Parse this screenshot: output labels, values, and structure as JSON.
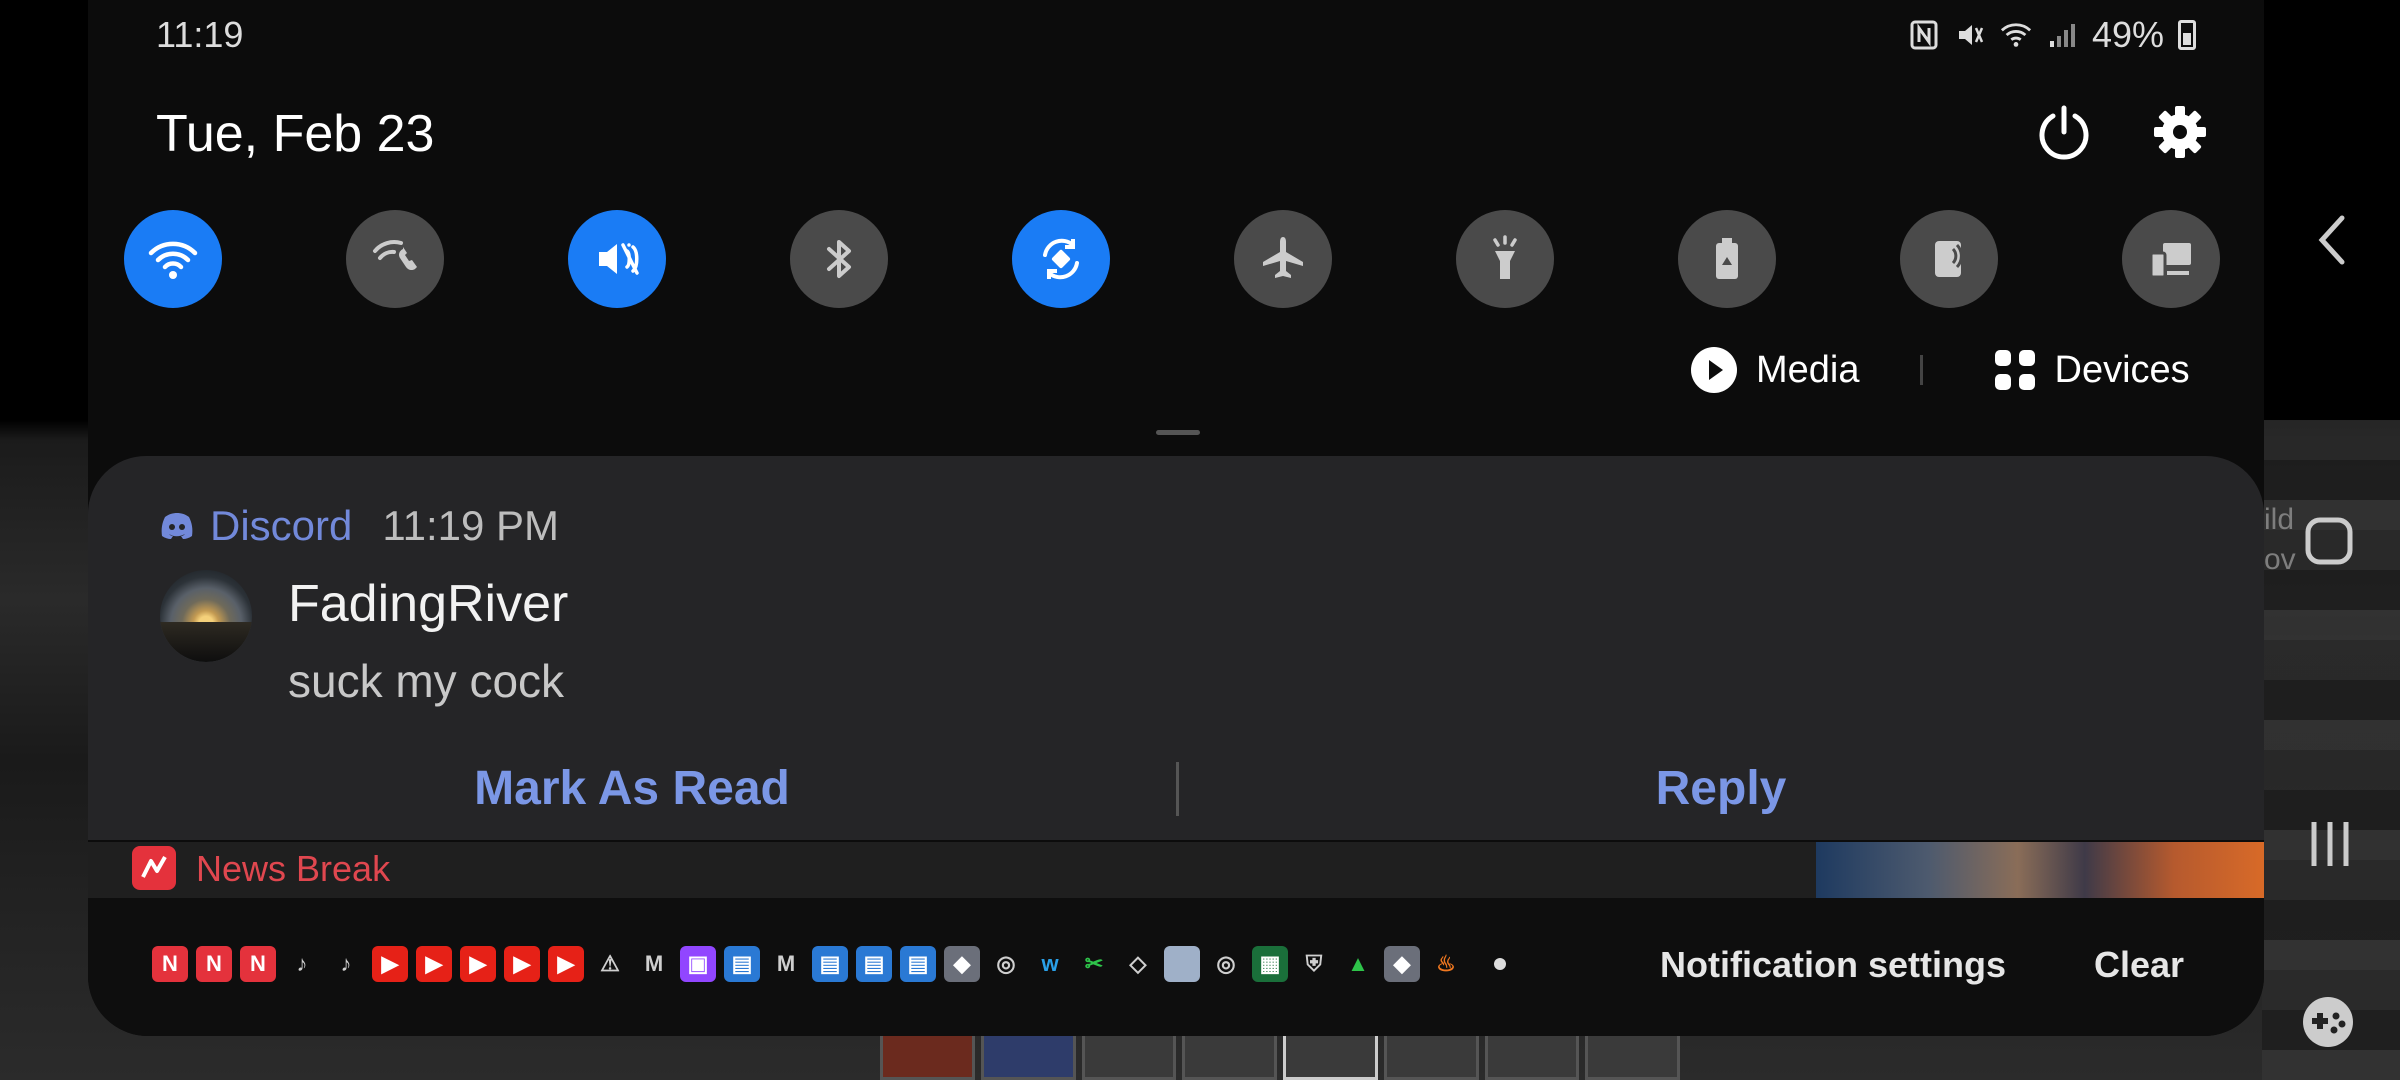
{
  "status_bar": {
    "time": "11:19",
    "battery": "49%",
    "icons": [
      "nfc-icon",
      "vibrate-mute-icon",
      "wifi-icon",
      "signal-icon",
      "battery-icon"
    ]
  },
  "header": {
    "date": "Tue, Feb 23",
    "power_icon": "power-icon",
    "settings_icon": "gear-icon"
  },
  "quick_settings": [
    {
      "name": "wifi",
      "icon": "wifi-icon",
      "on": true
    },
    {
      "name": "wifi-calling",
      "icon": "wifi-call-icon",
      "on": false
    },
    {
      "name": "sound-mode",
      "icon": "vibrate-icon",
      "on": true
    },
    {
      "name": "bluetooth",
      "icon": "bluetooth-icon",
      "on": false
    },
    {
      "name": "auto-rotate",
      "icon": "rotate-icon",
      "on": true
    },
    {
      "name": "airplane-mode",
      "icon": "airplane-icon",
      "on": false
    },
    {
      "name": "flashlight",
      "icon": "flashlight-icon",
      "on": false
    },
    {
      "name": "power-saving",
      "icon": "battery-saver-icon",
      "on": false
    },
    {
      "name": "nfc",
      "icon": "nfc-payment-icon",
      "on": false
    },
    {
      "name": "smart-view",
      "icon": "device-link-icon",
      "on": false
    }
  ],
  "media_devices": {
    "media_label": "Media",
    "devices_label": "Devices"
  },
  "notification": {
    "app_name": "Discord",
    "time": "11:19 PM",
    "sender": "FadingRiver",
    "message": "suck my cock",
    "actions": [
      "Mark As Read",
      "Reply"
    ],
    "accent_color": "#7289da"
  },
  "news_row": {
    "app_name": "News Break",
    "accent_color": "#e4323c"
  },
  "bottom_bar": {
    "app_icons": [
      {
        "name": "newsbreak",
        "color": "#e4323c",
        "glyph": "N"
      },
      {
        "name": "newsbreak",
        "color": "#e4323c",
        "glyph": "N"
      },
      {
        "name": "newsbreak",
        "color": "#e4323c",
        "glyph": "N"
      },
      {
        "name": "tiktok",
        "color": "transparent",
        "glyph": "♪"
      },
      {
        "name": "tiktok",
        "color": "transparent",
        "glyph": "♪"
      },
      {
        "name": "youtube",
        "color": "#e62117",
        "glyph": "▶"
      },
      {
        "name": "youtube",
        "color": "#e62117",
        "glyph": "▶"
      },
      {
        "name": "youtube",
        "color": "#e62117",
        "glyph": "▶"
      },
      {
        "name": "youtube",
        "color": "#e62117",
        "glyph": "▶"
      },
      {
        "name": "youtube",
        "color": "#e62117",
        "glyph": "▶"
      },
      {
        "name": "warning",
        "color": "transparent",
        "glyph": "⚠"
      },
      {
        "name": "gmail",
        "color": "transparent",
        "glyph": "M"
      },
      {
        "name": "twitch",
        "color": "#9146ff",
        "glyph": "▣"
      },
      {
        "name": "news",
        "color": "#2a79d4",
        "glyph": "▤"
      },
      {
        "name": "gmail",
        "color": "transparent",
        "glyph": "M"
      },
      {
        "name": "news",
        "color": "#2a79d4",
        "glyph": "▤"
      },
      {
        "name": "news",
        "color": "#2a79d4",
        "glyph": "▤"
      },
      {
        "name": "news",
        "color": "#2a79d4",
        "glyph": "▤"
      },
      {
        "name": "app",
        "color": "#6b6f7a",
        "glyph": "◆"
      },
      {
        "name": "instagram",
        "color": "transparent",
        "glyph": "◎"
      },
      {
        "name": "wattpad",
        "color": "transparent",
        "glyph": "w"
      },
      {
        "name": "app",
        "color": "transparent",
        "glyph": "✂"
      },
      {
        "name": "gem",
        "color": "transparent",
        "glyph": "◇"
      },
      {
        "name": "blank",
        "color": "#9fb0c8",
        "glyph": ""
      },
      {
        "name": "instagram",
        "color": "transparent",
        "glyph": "◎"
      },
      {
        "name": "gallery",
        "color": "#1a6f3a",
        "glyph": "▦"
      },
      {
        "name": "shield",
        "color": "transparent",
        "glyph": "⛨"
      },
      {
        "name": "hat",
        "color": "transparent",
        "glyph": "▲"
      },
      {
        "name": "app",
        "color": "#6b6f7a",
        "glyph": "◆"
      },
      {
        "name": "fire",
        "color": "transparent",
        "glyph": "♨"
      }
    ],
    "notification_settings_label": "Notification settings",
    "clear_label": "Clear"
  },
  "background": {
    "fragment_text": "ild\nov"
  }
}
